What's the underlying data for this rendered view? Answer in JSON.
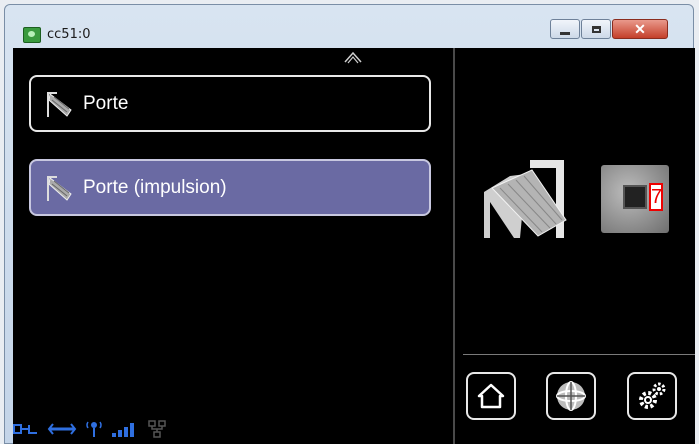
{
  "window": {
    "title": "cc51:0"
  },
  "colors": {
    "selected_row": "#6a6aa3",
    "screen_bg": "#000000",
    "badge_red": "#e00000"
  },
  "screen": {
    "items": [
      {
        "label": "Porte",
        "selected": false,
        "icon": "door-icon"
      },
      {
        "label": "Porte (impulsion)",
        "selected": true,
        "icon": "door-icon"
      }
    ],
    "module": {
      "number": "7"
    },
    "nav": [
      {
        "name": "home",
        "icon": "home-icon"
      },
      {
        "name": "network",
        "icon": "network-sphere-icon"
      },
      {
        "name": "settings",
        "icon": "gears-icon"
      }
    ],
    "status_icons": [
      "plug-icon",
      "link-icon",
      "antenna-icon",
      "signal-bars-icon",
      "lan-icon"
    ]
  }
}
